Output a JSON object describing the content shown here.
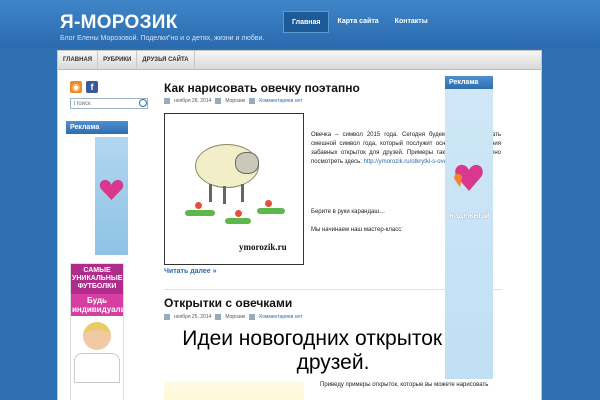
{
  "header": {
    "site_title": "Я-МОРОЗИК",
    "site_description": "Блог Елены Морозовой. Поделки\"но и о детях, жизни и любви.",
    "nav": [
      "Главная",
      "Карта сайта",
      "Контакты"
    ]
  },
  "subnav": [
    "ГЛАВНАЯ",
    "РУБРИКИ",
    "ДРУЗЬЯ САЙТА"
  ],
  "sidebar": {
    "search_placeholder": "Поиск",
    "ad_title": "Реклама",
    "tshirt_banner": {
      "line1": "САМЫЕ УНИКАЛЬНЫЕ ФУТБОЛКИ",
      "line2": "Будь индивидуальным!"
    }
  },
  "right_sidebar": {
    "ad_title": "Реклама",
    "ad_word": "надежный"
  },
  "posts": [
    {
      "title": "Как нарисовать овечку поэтапно",
      "date": "ноября 28, 2014",
      "author": "Морозик",
      "comments": "Комментариев нет",
      "image_caption": "ymorozik.ru",
      "text": "Овечка – символ 2015 года. Сегодня будем учиться рисовать смешной символ года, который послужит основой для создания забавных открыток для друзей. Примеры таких открыток можно посмотреть здесь:",
      "link": "http://ymorozik.ru/otkrytki-s-ovechkami/",
      "para2": "Берите в руки карандаш…",
      "para3": "Мы начинаем наш мастер-класс:",
      "read_more": "Читать далее »"
    },
    {
      "title": "Открытки с овечками",
      "date": "ноября 25, 2014",
      "author": "Морозик",
      "comments": "Комментариев нет",
      "image_title": "Идеи новогодних открыток для друзей.",
      "text": "Приведу примеры открыток, которые вы можете нарисовать"
    }
  ],
  "colors": {
    "header_blue": "#2d6fb0",
    "link_blue": "#2a6bb0",
    "heart_pink": "#d8398f",
    "heart_orange": "#f0862a"
  }
}
